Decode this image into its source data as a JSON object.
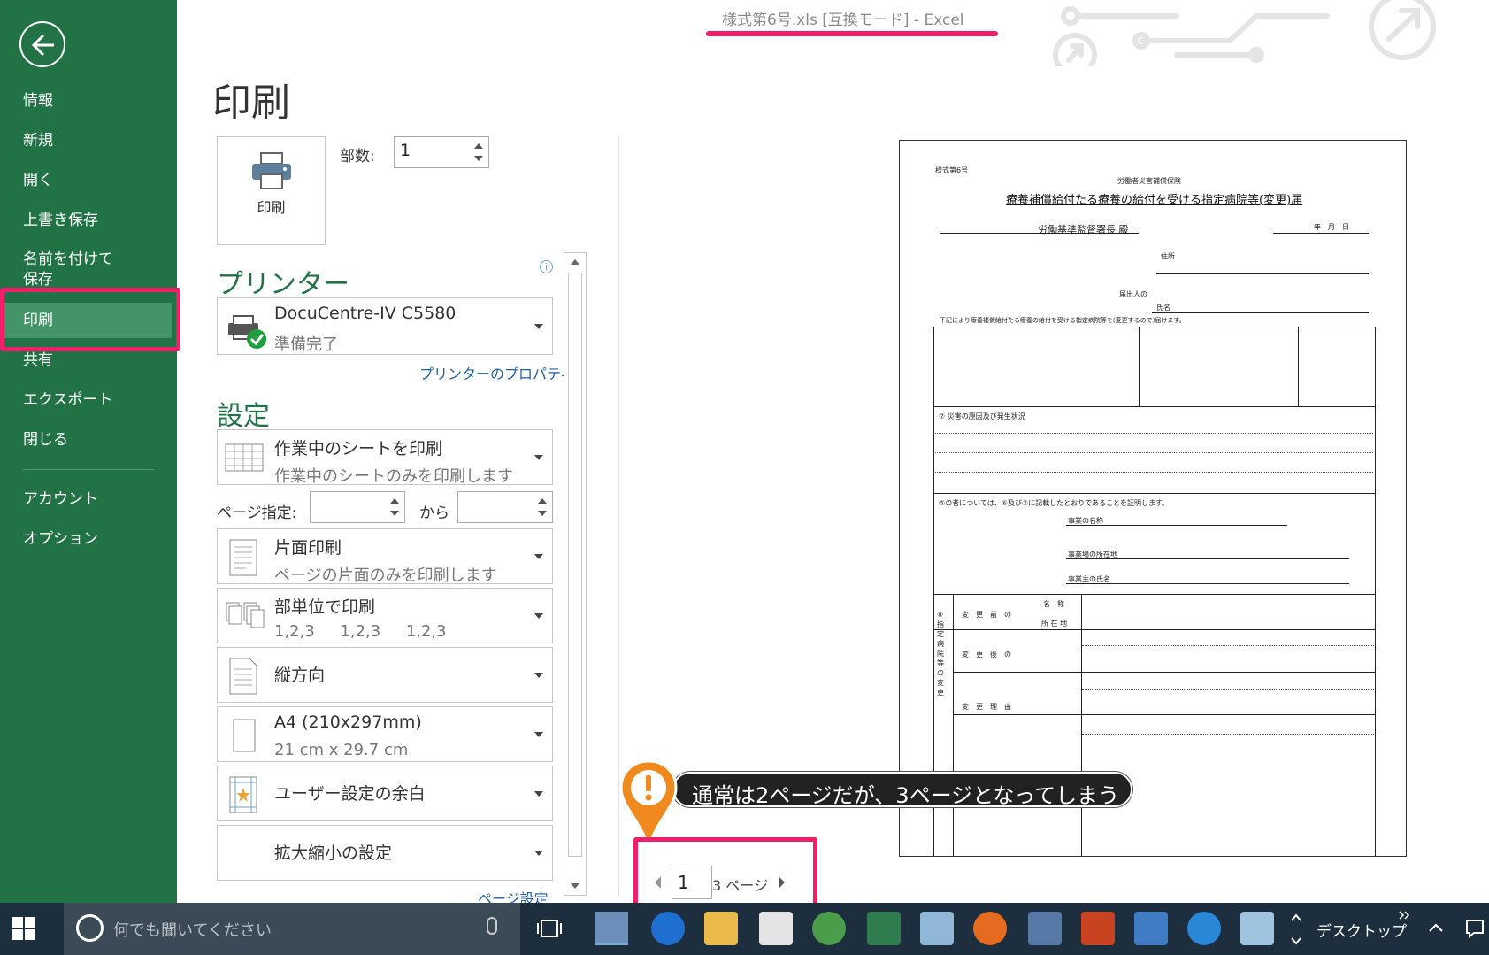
{
  "window": {
    "title": "様式第6号.xls  [互換モード] - Excel"
  },
  "sidebar": {
    "back_icon": "back-arrow-icon",
    "items": [
      {
        "label": "情報"
      },
      {
        "label": "新規"
      },
      {
        "label": "開く"
      },
      {
        "label": "上書き保存"
      },
      {
        "label": "名前を付けて\n保存"
      },
      {
        "label": "印刷",
        "active": true
      },
      {
        "label": "共有"
      },
      {
        "label": "エクスポート"
      },
      {
        "label": "閉じる"
      },
      {
        "label": "アカウント"
      },
      {
        "label": "オプション"
      }
    ]
  },
  "print": {
    "page_title": "印刷",
    "print_button_label": "印刷",
    "copies_label": "部数:",
    "copies_value": "1"
  },
  "printer": {
    "heading": "プリンター",
    "name": "DocuCentre-IV C5580",
    "status": "準備完了",
    "properties_link": "プリンターのプロパティ"
  },
  "settings": {
    "heading": "設定",
    "scope": {
      "main": "作業中のシートを印刷",
      "sub": "作業中のシートのみを印刷します"
    },
    "pages_label": "ページ指定:",
    "from_label": "から",
    "sides": {
      "main": "片面印刷",
      "sub": "ページの片面のみを印刷します"
    },
    "collate": {
      "main": "部単位で印刷",
      "sub": "1,2,3     1,2,3     1,2,3"
    },
    "orientation": {
      "main": "縦方向"
    },
    "paper": {
      "main": "A4 (210x297mm)",
      "sub": "21 cm x 29.7 cm"
    },
    "margins": {
      "main": "ユーザー設定の余白"
    },
    "scaling": {
      "main": "拡大縮小の設定"
    },
    "page_setup_link": "ページ設定"
  },
  "preview": {
    "form_no": "様式第6号",
    "org": "労働者災害補償保険",
    "title": "療養補償給付たる療養の給付を受ける指定病院等(変更)届",
    "addressee": "労働基準監督署長 殿",
    "date": "年　月　日",
    "applicant": "届出人の",
    "name_label": "氏名",
    "address_label": "住所",
    "intro": "下記により療養補償給付たる療養の給付を受ける指定病院等を(変更するので)届けます。",
    "section_a": "⑦ 災害の原因及び発生状況",
    "section_b": "⑤の者については、⑥及び⑦に記載したとおりであることを証明します。",
    "employer_label": "事業の名称",
    "employer_addr": "事業場の所在地",
    "employer_name": "事業主の氏名",
    "change_before": "変　更　前　の",
    "change_after": "変　更　後　の",
    "change_reason": "変　更　理　由",
    "name_col": "名　称",
    "addr_col": "所 在 地",
    "side_label": "⑧指定病院等の変更"
  },
  "callout": {
    "text": "通常は2ページだが、3ページとなってしまう"
  },
  "page_nav": {
    "current": "1",
    "total": "3 ページ"
  },
  "taskbar": {
    "search_placeholder": "何でも聞いてください",
    "desktop_label": "デスクトップ"
  },
  "colors": {
    "accent": "#217346",
    "highlight": "#ef1f6a",
    "taskbar": "#1d2f3f"
  }
}
